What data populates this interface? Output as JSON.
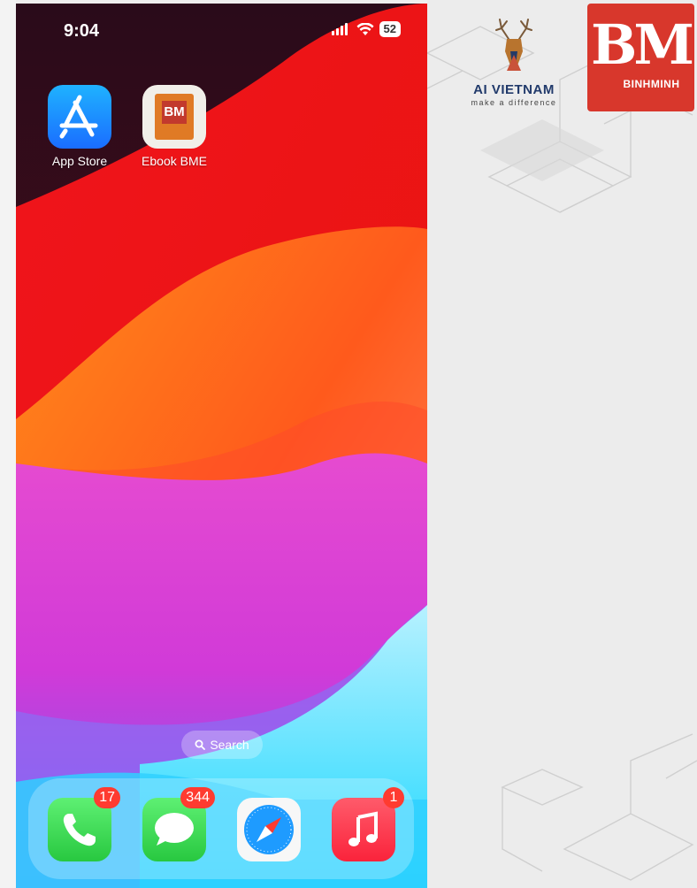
{
  "status_bar": {
    "time": "9:04",
    "battery": "52"
  },
  "home_apps": [
    {
      "label": "App Store",
      "icon": "app-store-icon"
    },
    {
      "label": "Ebook BME",
      "icon": "ebook-bme-icon",
      "icon_text": "BM"
    }
  ],
  "search": {
    "label": "Search"
  },
  "dock": [
    {
      "app": "Phone",
      "icon": "phone-icon",
      "badge": "17"
    },
    {
      "app": "Messages",
      "icon": "messages-icon",
      "badge": "344"
    },
    {
      "app": "Safari",
      "icon": "safari-icon"
    },
    {
      "app": "Music",
      "icon": "music-icon",
      "badge": "1"
    }
  ],
  "branding": {
    "ai_name": "AI VIETNAM",
    "ai_tagline": "make a difference",
    "bm_mark": "BM",
    "bm_name": "BINHMINH"
  },
  "colors": {
    "bm_red": "#d8372c",
    "ai_navy": "#213a6b",
    "badge_red": "#ff3b30"
  }
}
